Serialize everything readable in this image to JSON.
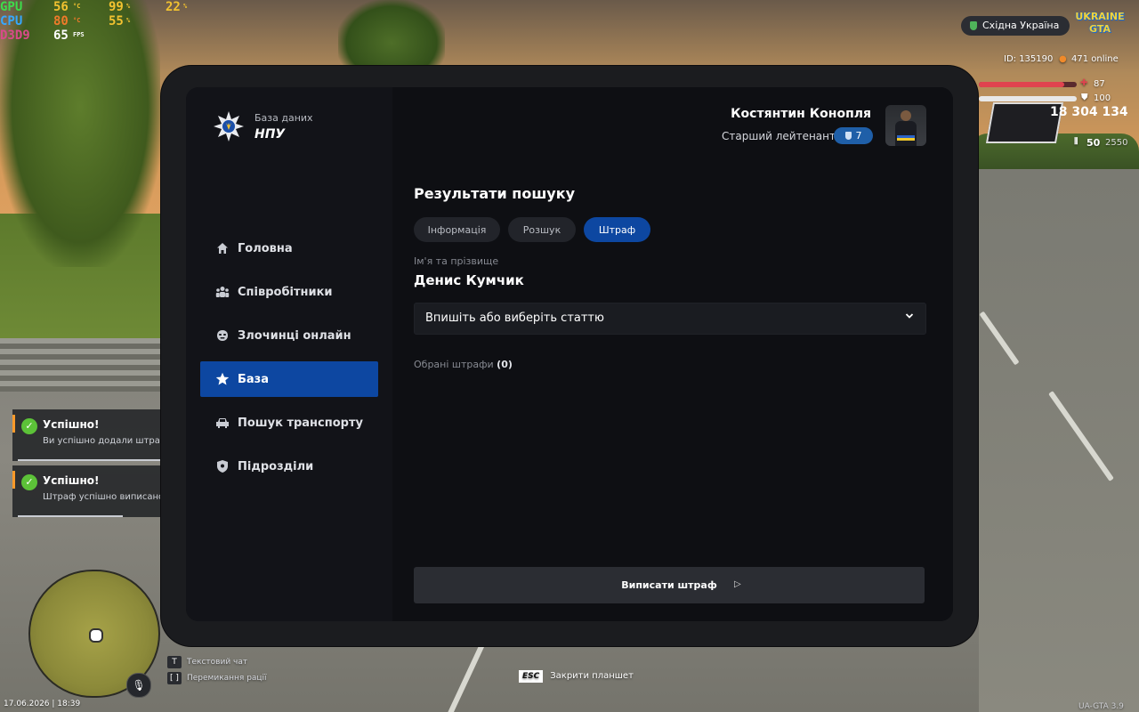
{
  "overlay_stats": {
    "gpu": {
      "label": "GPU",
      "temp": "56",
      "temp_unit": "°C",
      "load": "99",
      "load_unit": "%",
      "clock": "22",
      "clock_unit": "%"
    },
    "cpu": {
      "label": "CPU",
      "temp": "80",
      "temp_unit": "°C",
      "load": "55",
      "load_unit": "%"
    },
    "d3d": {
      "label": "D3D9",
      "fps": "65",
      "fps_unit": "FPS"
    }
  },
  "hud": {
    "server_region": "Східна Україна",
    "server_logo": "UKRAINE GTA",
    "player_id": "ID: 135190",
    "online": "471 online",
    "health": "87",
    "health_level": 0.87,
    "armor": "100",
    "armor_level": 1.0,
    "money": "18 304 134",
    "ammo_clip": "50",
    "ammo_total": "2550",
    "date_time": "17.06.2026 | 18:39",
    "version": "UA-GTA 3.9"
  },
  "notifications": [
    {
      "title": "Успішно!",
      "text": "Ви успішно додали штраф"
    },
    {
      "title": "Успішно!",
      "text": "Штраф успішно виписано"
    }
  ],
  "hints": [
    {
      "key": "T",
      "label": "Текстовий чат"
    },
    {
      "key": "[ ]",
      "label": "Перемикання рації"
    }
  ],
  "close_hint": {
    "key": "ESC",
    "label": "Закрити планшет"
  },
  "tablet": {
    "brand": {
      "caption": "База даних",
      "name": "НПУ"
    },
    "nav": [
      {
        "label": "Головна",
        "icon": "home-icon"
      },
      {
        "label": "Співробітники",
        "icon": "people-icon"
      },
      {
        "label": "Злочинці онлайн",
        "icon": "mask-icon"
      },
      {
        "label": "База",
        "icon": "star-icon",
        "active": true
      },
      {
        "label": "Пошук транспорту",
        "icon": "car-icon"
      },
      {
        "label": "Підрозділи",
        "icon": "shield-icon"
      }
    ],
    "user": {
      "name": "Костянтин Конопля",
      "rank": "Старший лейтенант",
      "level": "7"
    },
    "section_title": "Результати пошуку",
    "tabs": [
      {
        "label": "Інформація"
      },
      {
        "label": "Розшук"
      },
      {
        "label": "Штраф",
        "active": true
      }
    ],
    "name_label": "Ім'я та прізвище",
    "person_name": "Денис Кумчик",
    "article_select": {
      "value": "Впишіть або виберіть статтю"
    },
    "chosen_label": "Обрані штрафи",
    "chosen_count": "(0)",
    "submit_label": "Виписати штраф"
  },
  "colors": {
    "accent": "#0d47a1",
    "success": "#5cc238",
    "health": "#e0434f"
  }
}
